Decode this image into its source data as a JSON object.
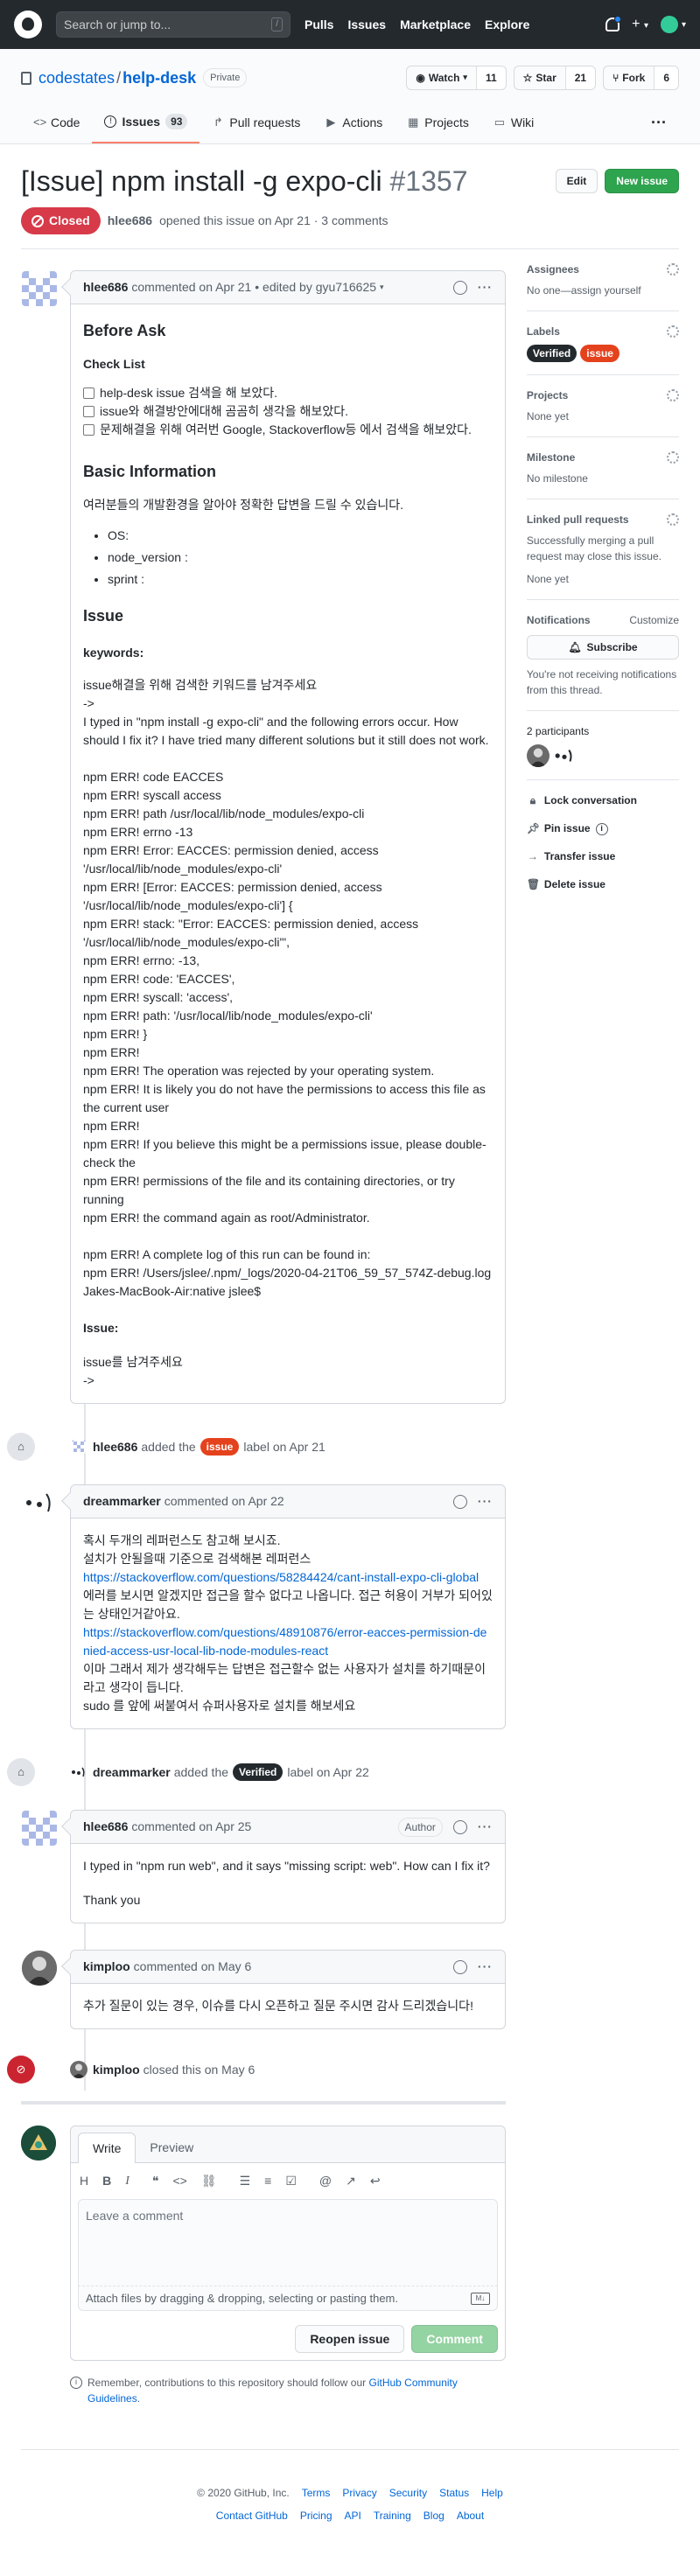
{
  "header": {
    "search_placeholder": "Search or jump to...",
    "search_key": "/",
    "nav": [
      "Pulls",
      "Issues",
      "Marketplace",
      "Explore"
    ],
    "plus": "+"
  },
  "repo": {
    "owner": "codestates",
    "sep": "/",
    "name": "help-desk",
    "visibility": "Private",
    "watch_label": "Watch",
    "watch_count": "11",
    "star_label": "Star",
    "star_count": "21",
    "fork_label": "Fork",
    "fork_count": "6"
  },
  "tabs": [
    {
      "label": "Code",
      "icon": "<>"
    },
    {
      "label": "Issues",
      "icon": "!",
      "count": "93"
    },
    {
      "label": "Pull requests",
      "icon": "↱"
    },
    {
      "label": "Actions",
      "icon": "▶"
    },
    {
      "label": "Projects",
      "icon": "▦"
    },
    {
      "label": "Wiki",
      "icon": "▭"
    }
  ],
  "issue": {
    "title": "[Issue] npm install -g expo-cli",
    "number": "#1357",
    "edit_label": "Edit",
    "new_label": "New issue",
    "state": "Closed",
    "author": "hlee686",
    "opened_text": "opened this issue on Apr 21 · 3 comments"
  },
  "comment1": {
    "author": "hlee686",
    "meta": "commented on Apr 21 • edited by gyu716625",
    "h_before": "Before Ask",
    "h_check": "Check List",
    "tasks": [
      "help-desk issue 검색을 해 보았다.",
      "issue와 해결방안에대해 곰곰히 생각을 해보았다.",
      "문제해결을 위해 여러번 Google, Stackoverflow등 에서 검색을 해보았다."
    ],
    "h_basic": "Basic Information",
    "basic_desc": "여러분들의 개발환경을 알아야 정확한 답변을 드릴 수 있습니다.",
    "bullets": [
      "OS:",
      "node_version :",
      "sprint :"
    ],
    "h_issue": "Issue",
    "h_keywords": "keywords:",
    "p1": "issue해결을 위해 검색한 키워드를 남겨주세요\n->\nI typed in \"npm install -g expo-cli\" and the following errors occur. How should I fix it? I have tried many different solutions but it still does not work.",
    "log": "npm ERR! code EACCES\nnpm ERR! syscall access\nnpm ERR! path /usr/local/lib/node_modules/expo-cli\nnpm ERR! errno -13\nnpm ERR! Error: EACCES: permission denied, access '/usr/local/lib/node_modules/expo-cli'\nnpm ERR! [Error: EACCES: permission denied, access '/usr/local/lib/node_modules/expo-cli'] {\nnpm ERR! stack: \"Error: EACCES: permission denied, access '/usr/local/lib/node_modules/expo-cli'\",\nnpm ERR! errno: -13,\nnpm ERR! code: 'EACCES',\nnpm ERR! syscall: 'access',\nnpm ERR! path: '/usr/local/lib/node_modules/expo-cli'\nnpm ERR! }\nnpm ERR!\nnpm ERR! The operation was rejected by your operating system.\nnpm ERR! It is likely you do not have the permissions to access this file as the current user\nnpm ERR!\nnpm ERR! If you believe this might be a permissions issue, please double-check the\nnpm ERR! permissions of the file and its containing directories, or try running\nnpm ERR! the command again as root/Administrator.",
    "log2": "npm ERR! A complete log of this run can be found in:\nnpm ERR! /Users/jslee/.npm/_logs/2020-04-21T06_59_57_574Z-debug.log\nJakes-MacBook-Air:native jslee$",
    "h_issue2": "Issue:",
    "p2": "issue를 남겨주세요\n->"
  },
  "event1": {
    "actor": "hlee686",
    "pre": "added the",
    "label": "issue",
    "post": "label on Apr 21"
  },
  "comment2": {
    "author": "dreammarker",
    "meta": "commented on Apr 22",
    "l1": "혹시 두개의 레퍼런스도 참고해 보시죠.",
    "l2": "설치가 안될을때 기준으로 검색해본 레퍼런스",
    "link1": "https://stackoverflow.com/questions/58284424/cant-install-expo-cli-global",
    "l3": "에러를 보시면 알겠지만 접근을 할수 없다고 나옵니다. 접근 허용이 거부가 되어있는 상태인거같아요.",
    "link2": "https://stackoverflow.com/questions/48910876/error-eacces-permission-denied-access-usr-local-lib-node-modules-react",
    "l4": "이마 그래서 제가 생각해두는 답변은 접근할수 없는 사용자가 설치를 하기때문이라고 생각이 듭니다.",
    "l5": "sudo 를 앞에 써붙여서 슈퍼사용자로 설치를 해보세요"
  },
  "event2": {
    "actor": "dreammarker",
    "pre": "added the",
    "label": "Verified",
    "post": "label on Apr 22"
  },
  "comment3": {
    "author": "hlee686",
    "meta": "commented on Apr 25",
    "badge": "Author",
    "p1": "I typed in \"npm run web\", and it says \"missing script: web\". How can I fix it?",
    "p2": "Thank you"
  },
  "comment4": {
    "author": "kimploo",
    "meta": "commented on May 6",
    "p1": "추가 질문이 있는 경우, 이슈를 다시 오픈하고 질문 주시면 감사 드리겠습니다!"
  },
  "event3": {
    "actor": "kimploo",
    "text": "closed this on May 6"
  },
  "composer": {
    "tab_write": "Write",
    "tab_preview": "Preview",
    "placeholder": "Leave a comment",
    "attach": "Attach files by dragging & dropping, selecting or pasting them.",
    "md": "M↓",
    "reopen": "Reopen issue",
    "comment": "Comment",
    "remember_pre": "Remember, contributions to this repository should follow our",
    "remember_link": "GitHub Community Guidelines",
    "remember_post": "."
  },
  "sidebar": {
    "assignees_h": "Assignees",
    "assignees_v": "No one—assign yourself",
    "labels_h": "Labels",
    "labels": [
      "Verified",
      "issue"
    ],
    "projects_h": "Projects",
    "projects_v": "None yet",
    "milestone_h": "Milestone",
    "milestone_v": "No milestone",
    "linked_h": "Linked pull requests",
    "linked_desc": "Successfully merging a pull request may close this issue.",
    "linked_v": "None yet",
    "notif_h": "Notifications",
    "notif_customize": "Customize",
    "subscribe": "Subscribe",
    "notif_desc": "You're not receiving notifications from this thread.",
    "participants_h": "2 participants",
    "lock": "Lock conversation",
    "pin": "Pin issue",
    "transfer": "Transfer issue",
    "delete": "Delete issue"
  },
  "footer": {
    "copy": "© 2020 GitHub, Inc.",
    "row1": [
      "Terms",
      "Privacy",
      "Security",
      "Status",
      "Help"
    ],
    "row2": [
      "Contact GitHub",
      "Pricing",
      "API",
      "Training",
      "Blog",
      "About"
    ]
  },
  "colors": {
    "issue_label": "#e4421d",
    "verified_label": "#24292e",
    "closed": "#d73a49",
    "new_issue": "#2ea44f",
    "selected_tab": "#f9826c"
  }
}
